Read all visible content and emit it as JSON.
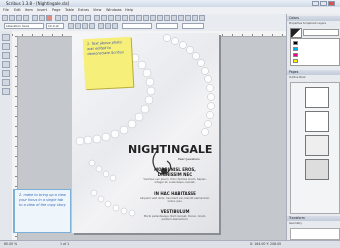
{
  "window": {
    "title": "Scribus 1.3.8 - [Nightingale.sla]"
  },
  "menu": [
    "File",
    "Edit",
    "Item",
    "Insert",
    "Page",
    "Table",
    "Extras",
    "View",
    "Windows",
    "Help"
  ],
  "toolbar": {
    "font_name": "Liberation Sans",
    "font_size": "12.0 pt",
    "zoom_label": "60.00 %"
  },
  "document": {
    "brand": "NIGHTINGALE",
    "brand_sub": "Pearl Jewellers",
    "s1_title": "MORBI NISL EROS,",
    "s1_title2": "DIGNISSIM NEC",
    "s1_text": "Vivamus nec ipsum. Proin facilisis lorem. Sapien. Integer at, scelerisque, laoreet.",
    "s2_title": "IN HAC HABITASSE",
    "s2_text": "Aliquam velit dolor, hendrerit vel, blandit elementum, luctus quis.",
    "s3_title": "VESTIBULUM",
    "s3_text": "Morbi pellentesque. Nam laoreet. Donec. lorem, pretium elementum."
  },
  "notes": {
    "yellow": "1. Text above photo was edited to demonstrate Scribus",
    "blue": "2. make to bring up a view your focus in a single tab to a view of the copy story"
  },
  "right_panel": {
    "colors_header": "Colors",
    "color_tabs": "Properties  Scrapbook  Layers",
    "pages_header": "Pages",
    "pages_tabs": "Outline  Book",
    "transform_header": "Transform",
    "transform_tab": "Geometry"
  },
  "status": {
    "zoom": "60.00 %",
    "page": "1 of 1",
    "coords": "X: 164.00  Y: 208.00"
  },
  "colors": {
    "note_yellow": "#f6ef7a",
    "note_blue": "#eef6fb",
    "accent": "#3b4fb0"
  }
}
